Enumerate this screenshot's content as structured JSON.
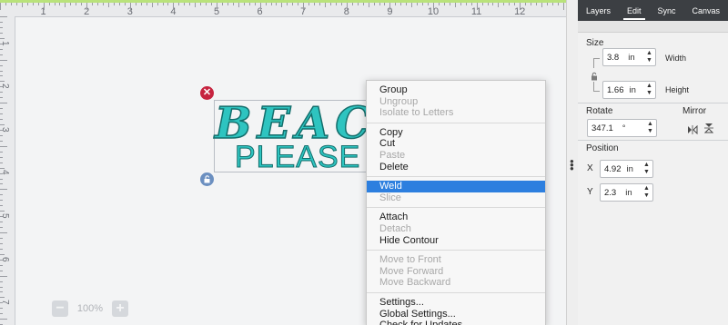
{
  "ruler": {
    "top_numbers": [
      "1",
      "2",
      "3",
      "4",
      "5",
      "6",
      "7",
      "8",
      "9",
      "10",
      "11",
      "12"
    ],
    "left_numbers": [
      "1",
      "2",
      "3",
      "4",
      "5",
      "6",
      "7"
    ]
  },
  "design": {
    "line1": "BEACH",
    "line2": "PLEASE"
  },
  "zoom": {
    "minus": "−",
    "value": "100%",
    "plus": "+"
  },
  "context_menu": {
    "groups": [
      [
        {
          "label": "Group",
          "enabled": true
        },
        {
          "label": "Ungroup",
          "enabled": false
        },
        {
          "label": "Isolate to Letters",
          "enabled": false
        }
      ],
      [
        {
          "label": "Copy",
          "enabled": true
        },
        {
          "label": "Cut",
          "enabled": true
        },
        {
          "label": "Paste",
          "enabled": false
        },
        {
          "label": "Delete",
          "enabled": true
        }
      ],
      [
        {
          "label": "Weld",
          "enabled": true,
          "selected": true
        },
        {
          "label": "Slice",
          "enabled": false
        }
      ],
      [
        {
          "label": "Attach",
          "enabled": true
        },
        {
          "label": "Detach",
          "enabled": false
        },
        {
          "label": "Hide Contour",
          "enabled": true
        }
      ],
      [
        {
          "label": "Move to Front",
          "enabled": false
        },
        {
          "label": "Move Forward",
          "enabled": false
        },
        {
          "label": "Move Backward",
          "enabled": false
        }
      ],
      [
        {
          "label": "Settings...",
          "enabled": true
        },
        {
          "label": "Global Settings...",
          "enabled": true
        },
        {
          "label": "Check for Updates...",
          "enabled": true
        }
      ]
    ]
  },
  "panel": {
    "tabs": [
      {
        "label": "Layers",
        "active": false
      },
      {
        "label": "Edit",
        "active": true
      },
      {
        "label": "Sync",
        "active": false
      },
      {
        "label": "Canvas",
        "active": false
      }
    ],
    "size": {
      "title": "Size",
      "width": {
        "value": "3.8",
        "unit": "in",
        "label": "Width"
      },
      "height": {
        "value": "1.66",
        "unit": "in",
        "label": "Height"
      }
    },
    "rotate": {
      "title": "Rotate",
      "value": "347.1",
      "unit": "°"
    },
    "mirror": {
      "title": "Mirror"
    },
    "position": {
      "title": "Position",
      "x": {
        "axis": "X",
        "value": "4.92",
        "unit": "in"
      },
      "y": {
        "axis": "Y",
        "value": "2.3",
        "unit": "in"
      }
    }
  },
  "colors": {
    "design_fill": "#2ec4c0",
    "menu_highlight": "#2d7fdf",
    "delete_handle": "#c6233f",
    "lock_handle": "#6b8fc0",
    "tab_bar": "#3c3f43",
    "ruler_accent": "#b9e27b"
  }
}
